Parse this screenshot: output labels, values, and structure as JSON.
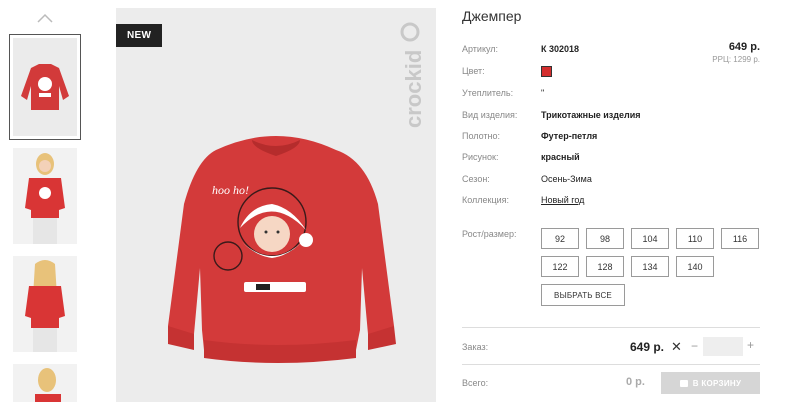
{
  "badge": "NEW",
  "brand_watermark": "crockid",
  "sweater_text": "hoo ho!",
  "product": {
    "title": "Джемпер",
    "price": "649 р.",
    "rrp": "РРЦ: 1299 р.",
    "color_hex": "#d42e2e"
  },
  "attributes": [
    {
      "label": "Артикул:",
      "value": "К 302018"
    },
    {
      "label": "Цвет:",
      "value": ""
    },
    {
      "label": "Утеплитель:",
      "value": "\""
    },
    {
      "label": "Вид изделия:",
      "value": "Трикотажные изделия"
    },
    {
      "label": "Полотно:",
      "value": "Футер-петля"
    },
    {
      "label": "Рисунок:",
      "value": "красный"
    },
    {
      "label": "Сезон:",
      "value": "Осень-Зима"
    },
    {
      "label": "Коллекция:",
      "value": "Новый год"
    }
  ],
  "size_label": "Рост/размер:",
  "sizes": [
    "92",
    "98",
    "104",
    "110",
    "116",
    "122",
    "128",
    "134",
    "140"
  ],
  "select_all": "ВЫБРАТЬ ВСЕ",
  "order": {
    "label": "Заказ:",
    "price": "649 р.",
    "close": "✕",
    "minus": "−",
    "plus": "+",
    "qty": ""
  },
  "total": {
    "label": "Всего:",
    "value": "0 р.",
    "cart_button": "В КОРЗИНУ"
  }
}
